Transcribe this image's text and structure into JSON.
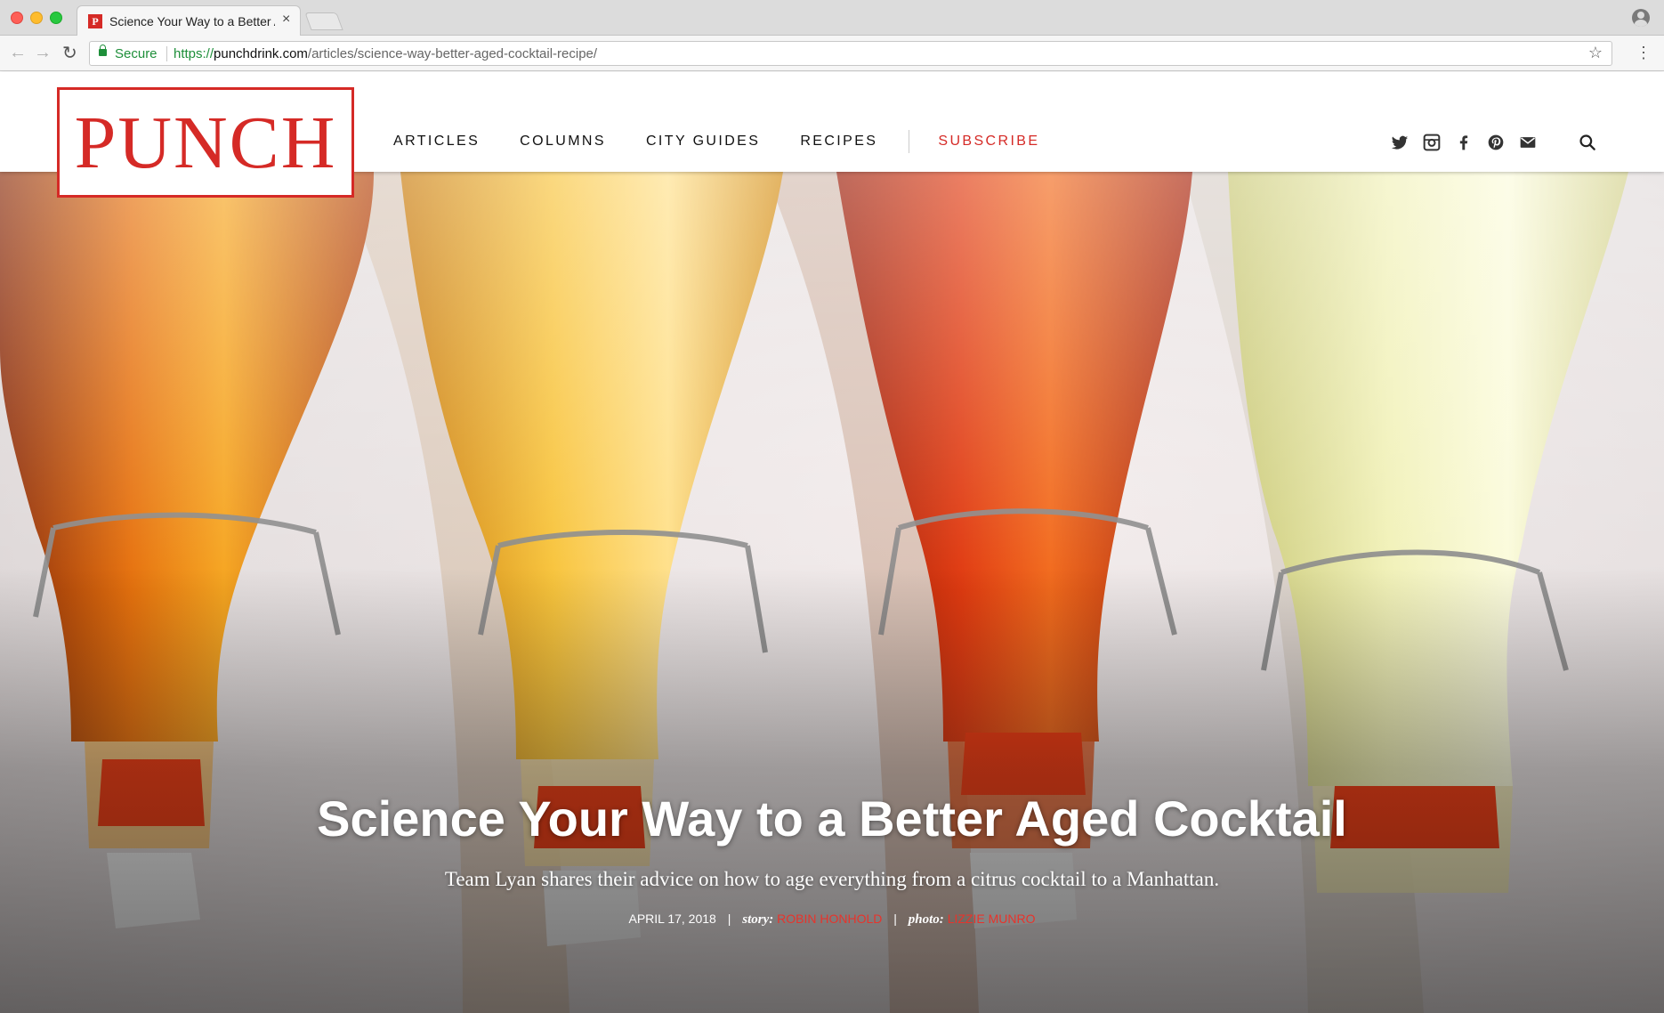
{
  "browser": {
    "tab_title": "Science Your Way to a Better A",
    "tab_favicon_letter": "P",
    "tab_close": "×",
    "secure_label": "Secure",
    "url_scheme": "https://",
    "url_host": "punchdrink.com",
    "url_path": "/articles/science-way-better-aged-cocktail-recipe/",
    "back_icon": "←",
    "forward_icon": "→",
    "reload_icon": "↻",
    "star_icon": "☆",
    "menu_icon": "⋮"
  },
  "site": {
    "logo": "PUNCH",
    "brand_color": "#d52a26",
    "nav": {
      "articles": "ARTICLES",
      "columns": "COLUMNS",
      "city_guides": "CITY GUIDES",
      "recipes": "RECIPES",
      "subscribe": "SUBSCRIBE"
    },
    "social_icons": [
      "twitter-icon",
      "instagram-icon",
      "facebook-icon",
      "pinterest-icon",
      "email-icon",
      "search-icon"
    ]
  },
  "hero": {
    "title": "Science Your Way to a Better Aged Cocktail",
    "dek": "Team Lyan shares their advice on how to age everything from a citrus cocktail to a Manhattan.",
    "date": "APRIL 17, 2018",
    "story_label": "story:",
    "story_author": "ROBIN HONHOLD",
    "photo_label": "photo:",
    "photo_author": "LIZZIE MUNRO",
    "separator": "|",
    "accent_color": "#e8332b"
  }
}
